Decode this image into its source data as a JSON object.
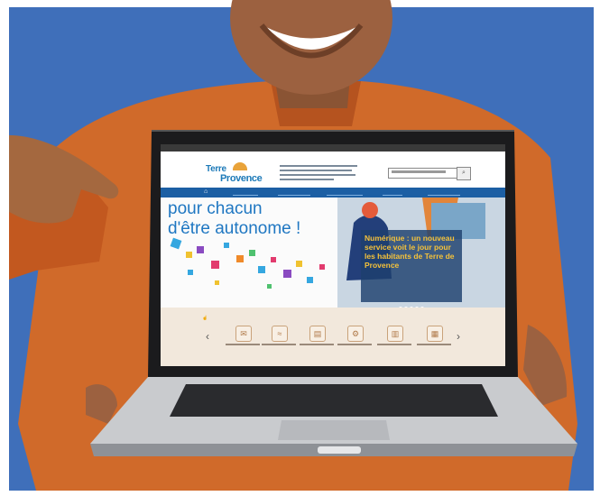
{
  "hero": {
    "title_line1": "pour chacun",
    "title_line2": "d'être autonome !",
    "news": "Numérique : un nouveau service voit le jour pour les habitants de Terre de Provence"
  },
  "logo": {
    "line1": "Terre",
    "line2": "Provence"
  },
  "shortcuts": {
    "arrow_left": "‹",
    "arrow_right": "›"
  },
  "colors": {
    "background": "#3f6fba",
    "shirt": "#d06a2a",
    "nav": "#1c5fa4",
    "headline": "#1f77c2",
    "news": "#f5c23a"
  },
  "icons": [
    "megaphone-icon",
    "wifi-icon",
    "newspaper-icon",
    "gear-icon",
    "trash-icon",
    "calendar-icon"
  ]
}
